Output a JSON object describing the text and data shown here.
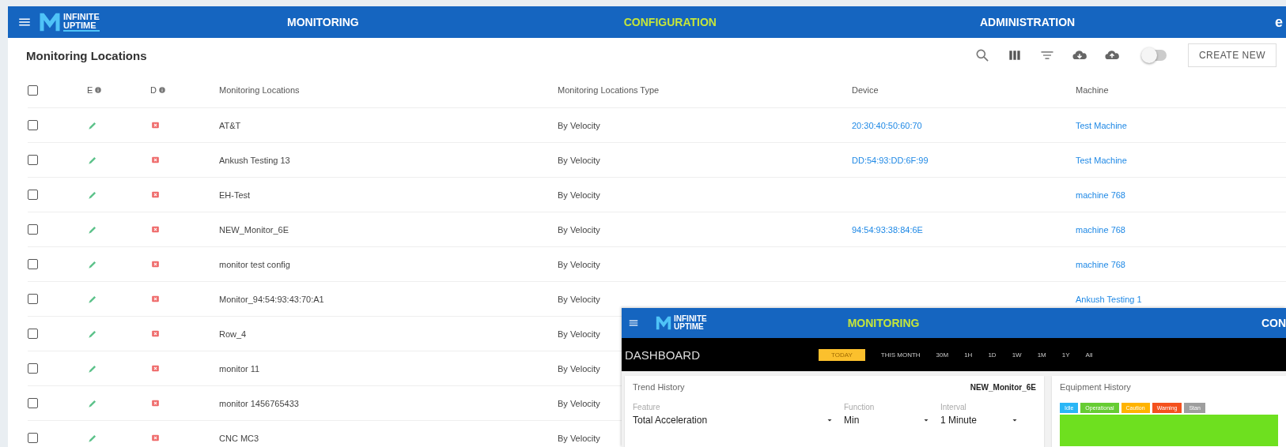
{
  "topbar": {
    "logo_text": [
      "INFINITE",
      "UPTIME"
    ],
    "nav": [
      {
        "label": "MONITORING",
        "selected": false
      },
      {
        "label": "CONFIGURATION",
        "selected": true
      },
      {
        "label": "ADMINISTRATION",
        "selected": false
      }
    ],
    "account_initial": "e"
  },
  "panel": {
    "title": "Monitoring Locations",
    "toggle_on": false,
    "create_button": "CREATE NEW"
  },
  "table": {
    "all_checked": false,
    "columns": [
      "E",
      "D",
      "Monitoring Locations",
      "Monitoring Locations Type",
      "Device",
      "Machine"
    ],
    "rows": [
      {
        "checked": false,
        "name": "AT&T",
        "type": "By Velocity",
        "device": "20:30:40:50:60:70",
        "machine": "Test Machine"
      },
      {
        "checked": false,
        "name": "Ankush Testing 13",
        "type": "By Velocity",
        "device": "DD:54:93:DD:6F:99",
        "machine": "Test Machine"
      },
      {
        "checked": false,
        "name": "EH-Test",
        "type": "By Velocity",
        "machine": "machine 768"
      },
      {
        "checked": false,
        "name": "NEW_Monitor_6E",
        "type": "By Velocity",
        "device": "94:54:93:38:84:6E",
        "machine": "machine 768"
      },
      {
        "checked": false,
        "name": "monitor test config",
        "type": "By Velocity",
        "machine": "machine 768"
      },
      {
        "checked": false,
        "name": "Monitor_94:54:93:43:70:A1",
        "type": "By Velocity",
        "machine": "Ankush Testing 1"
      },
      {
        "checked": false,
        "name": "Row_4",
        "type": "By Velocity"
      },
      {
        "checked": false,
        "name": "monitor 11",
        "type": "By Velocity"
      },
      {
        "checked": false,
        "name": "monitor 1456765433",
        "type": "By Velocity"
      },
      {
        "checked": false,
        "name": "CNC MC3",
        "type": "By Velocity"
      }
    ]
  },
  "dashboard_window": {
    "logo_text": [
      "INFINITE",
      "UPTIME"
    ],
    "nav": [
      {
        "label": "MONITORING",
        "selected": true
      },
      {
        "label": "CON",
        "selected": false
      }
    ],
    "title": "DASHBOARD",
    "ranges": [
      {
        "label": "TODAY",
        "selected": true
      },
      {
        "label": "THIS MONTH",
        "selected": false
      },
      {
        "label": "30M",
        "selected": false
      },
      {
        "label": "1H",
        "selected": false
      },
      {
        "label": "1D",
        "selected": false
      },
      {
        "label": "1W",
        "selected": false
      },
      {
        "label": "1M",
        "selected": false
      },
      {
        "label": "1Y",
        "selected": false
      },
      {
        "label": "All",
        "selected": false
      }
    ],
    "trend": {
      "title": "Trend History",
      "monitor": "NEW_Monitor_6E",
      "fields": [
        {
          "label": "Feature",
          "value": "Total Acceleration"
        },
        {
          "label": "Function",
          "value": "Min"
        },
        {
          "label": "Interval",
          "value": "1 Minute"
        }
      ]
    },
    "equipment": {
      "title": "Equipment History",
      "legend": [
        {
          "label": "Idle",
          "color": "#29b6f6"
        },
        {
          "label": "Operational",
          "color": "#66cc33"
        },
        {
          "label": "Caution",
          "color": "#ffb300"
        },
        {
          "label": "Warning",
          "color": "#f4511e"
        },
        {
          "label": "Stan",
          "color": "#9e9e9e"
        }
      ]
    }
  }
}
